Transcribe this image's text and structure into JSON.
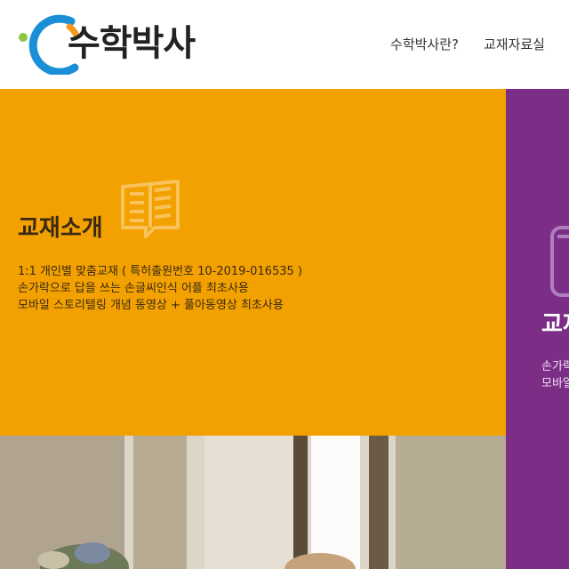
{
  "header": {
    "logo_text": "수학박사",
    "nav": [
      {
        "label": "수학박사란?"
      },
      {
        "label": "교재자료실"
      }
    ]
  },
  "intro_panel": {
    "title": "교재소개",
    "lines": [
      "1:1 개인별 맞춤교재 ( 특허출원번호 10-2019-016535 )",
      "손가락으로 답을 쓰는 손글씨인식 어플 최초사용",
      "모바일 스토리텔링 개념 동영상 + 풀아동영상 최초사용"
    ],
    "icon": "book-icon"
  },
  "side_panel": {
    "title": "교재",
    "lines": [
      "손가락으",
      "모바일"
    ],
    "icon": "tablet-icon"
  },
  "colors": {
    "orange": "#f3a100",
    "purple": "#7c2e87",
    "logo_blue": "#1a8fd8",
    "logo_orange": "#f39a1e",
    "logo_green": "#8cc63f"
  }
}
